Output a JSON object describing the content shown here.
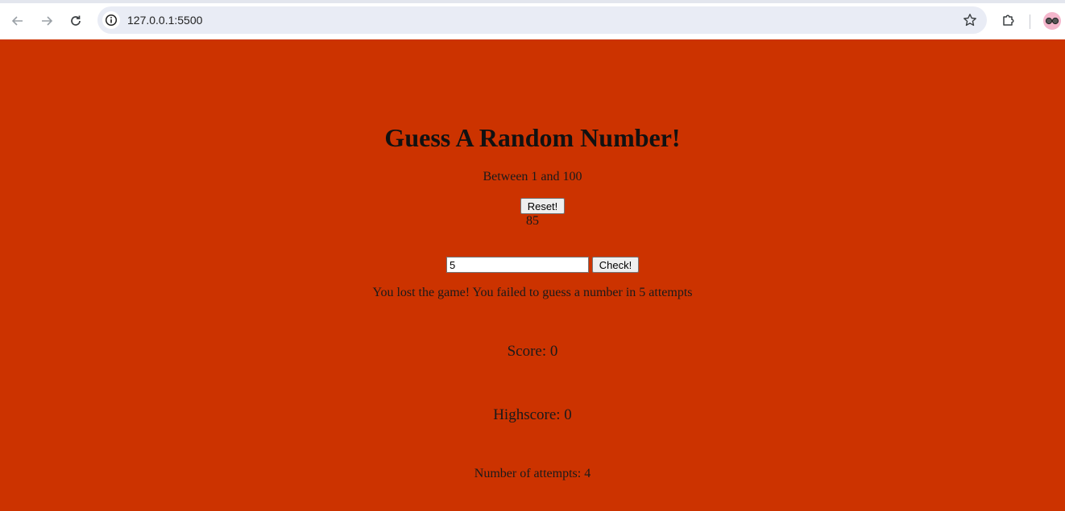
{
  "browser": {
    "url": "127.0.0.1:5500"
  },
  "game": {
    "title": "Guess A Random Number!",
    "range_text": "Between 1 and 100",
    "reset_label": "Reset!",
    "secret_number": "85",
    "guess_value": "5",
    "check_label": "Check!",
    "message": "You lost the game! You failed to guess a number in 5 attempts",
    "score_text": "Score: 0",
    "highscore_text": "Highscore: 0",
    "attempts_text": "Number of attempts: 4"
  },
  "colors": {
    "page_background": "#cc3300"
  }
}
